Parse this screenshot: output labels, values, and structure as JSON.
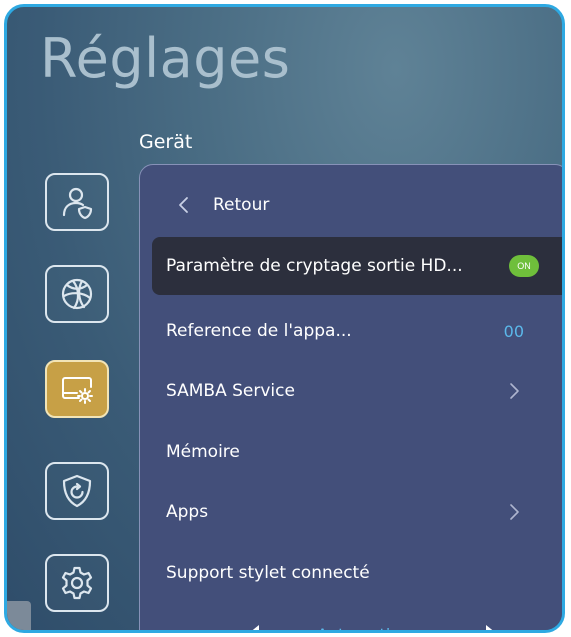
{
  "header": {
    "title": "Réglages"
  },
  "section": {
    "label": "Gerät"
  },
  "sidebar": {
    "items": [
      {
        "icon": "user-shield-icon",
        "active": false
      },
      {
        "icon": "globe-icon",
        "active": false
      },
      {
        "icon": "device-settings-icon",
        "active": true
      },
      {
        "icon": "shield-refresh-icon",
        "active": false
      },
      {
        "icon": "gear-icon",
        "active": false
      }
    ]
  },
  "panel": {
    "back_label": "Retour",
    "rows": [
      {
        "label": "Paramètre de cryptage sortie HD...",
        "toggle": "ON"
      },
      {
        "label": "Reference de l'appa...",
        "value": "00"
      },
      {
        "label": "SAMBA Service"
      },
      {
        "label": "Mémoire"
      },
      {
        "label": "Apps"
      },
      {
        "label": "Support stylet connecté"
      }
    ],
    "selector": {
      "value": "Automatique"
    }
  },
  "colors": {
    "accent_blue": "#5bb8ea",
    "toggle_on": "#6fbf3b",
    "active_icon": "#c7a046",
    "panel_bg": "#434f7a",
    "frame_border": "#2ea9e2"
  }
}
